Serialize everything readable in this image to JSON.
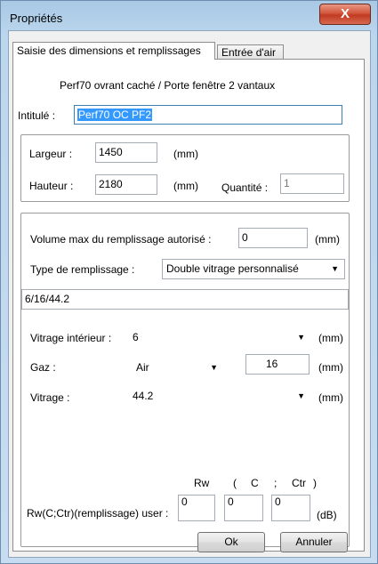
{
  "window": {
    "title": "Propriétés",
    "close_label": "X"
  },
  "tabs": [
    "Saisie des dimensions et remplissages",
    "Entrée d'air"
  ],
  "heading": "Perf70 ovrant caché / Porte fenêtre 2 vantaux",
  "intitule": {
    "label": "Intitulé :",
    "value": "Perf70 OC PF2"
  },
  "dimensions": {
    "largeur_label": "Largeur :",
    "largeur_value": "1450",
    "largeur_unit": "(mm)",
    "hauteur_label": "Hauteur :",
    "hauteur_value": "2180",
    "hauteur_unit": "(mm)",
    "quantite_label": "Quantité :",
    "quantite_value": "1"
  },
  "remplissage": {
    "volume_label": "Volume max du remplissage autorisé  :",
    "volume_value": "0",
    "volume_unit": "(mm)",
    "type_label": "Type de remplissage :",
    "type_value": "Double vitrage personnalisé",
    "composition": "6/16/44.2",
    "vitrage_int_label": "Vitrage intérieur :",
    "vitrage_int_value": "6",
    "vitrage_int_unit": "(mm)",
    "gaz_label": "Gaz :",
    "gaz_value": "Air",
    "gaz_thickness": "16",
    "gaz_unit": "(mm)",
    "vitrage_label": "Vitrage :",
    "vitrage_value": "44.2",
    "vitrage_unit": "(mm)"
  },
  "acoustique": {
    "h_rw": "Rw",
    "h_open": "(",
    "h_c": "C",
    "h_semi": ";",
    "h_ctr": "Ctr",
    "h_close": ")",
    "label": "Rw(C;Ctr)(remplissage) user :",
    "rw": "0",
    "c": "0",
    "ctr": "0",
    "unit": "(dB)"
  },
  "buttons": {
    "ok": "Ok",
    "cancel": "Annuler"
  },
  "icons": {
    "close": "close-icon",
    "dropdown": "chevron-down-icon"
  }
}
